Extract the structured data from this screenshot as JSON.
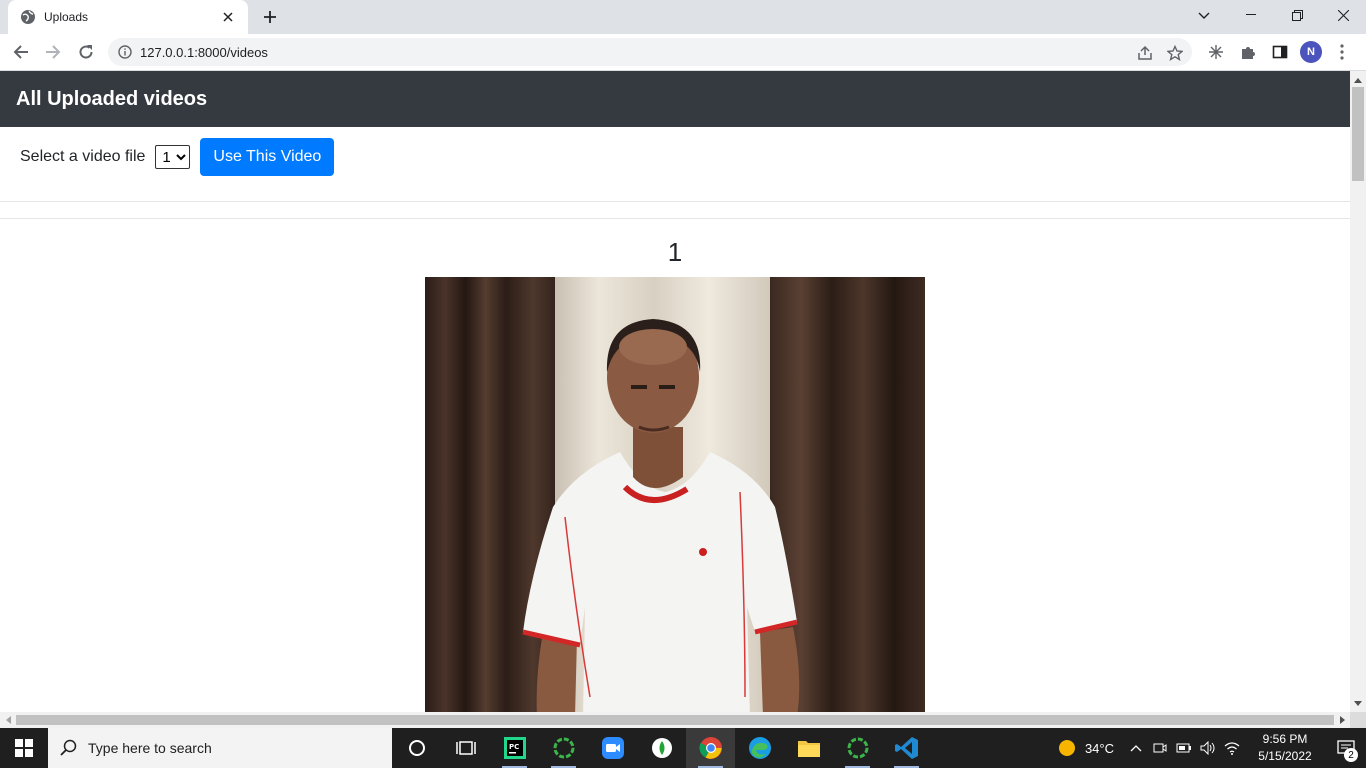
{
  "browser": {
    "tab_title": "Uploads",
    "url": "127.0.0.1:8000/videos",
    "profile_initial": "N"
  },
  "page": {
    "header_title": "All Uploaded videos",
    "select_label": "Select a video file",
    "select_value": "1",
    "select_options": [
      "1"
    ],
    "use_button_label": "Use This Video",
    "video_heading": "1"
  },
  "taskbar": {
    "search_placeholder": "Type here to search",
    "temperature": "34°C",
    "time": "9:56 PM",
    "date": "5/15/2022",
    "notification_count": "2",
    "apps": [
      "task-view",
      "pycharm",
      "app-green-ring",
      "zoom",
      "app-leaf",
      "chrome",
      "edge",
      "file-explorer",
      "app-green-ring-2",
      "vscode"
    ]
  },
  "colors": {
    "header_bg": "#343a40",
    "primary_button": "#007bff",
    "tabstrip": "#dee1e6",
    "taskbar": "#1f1f1f"
  }
}
